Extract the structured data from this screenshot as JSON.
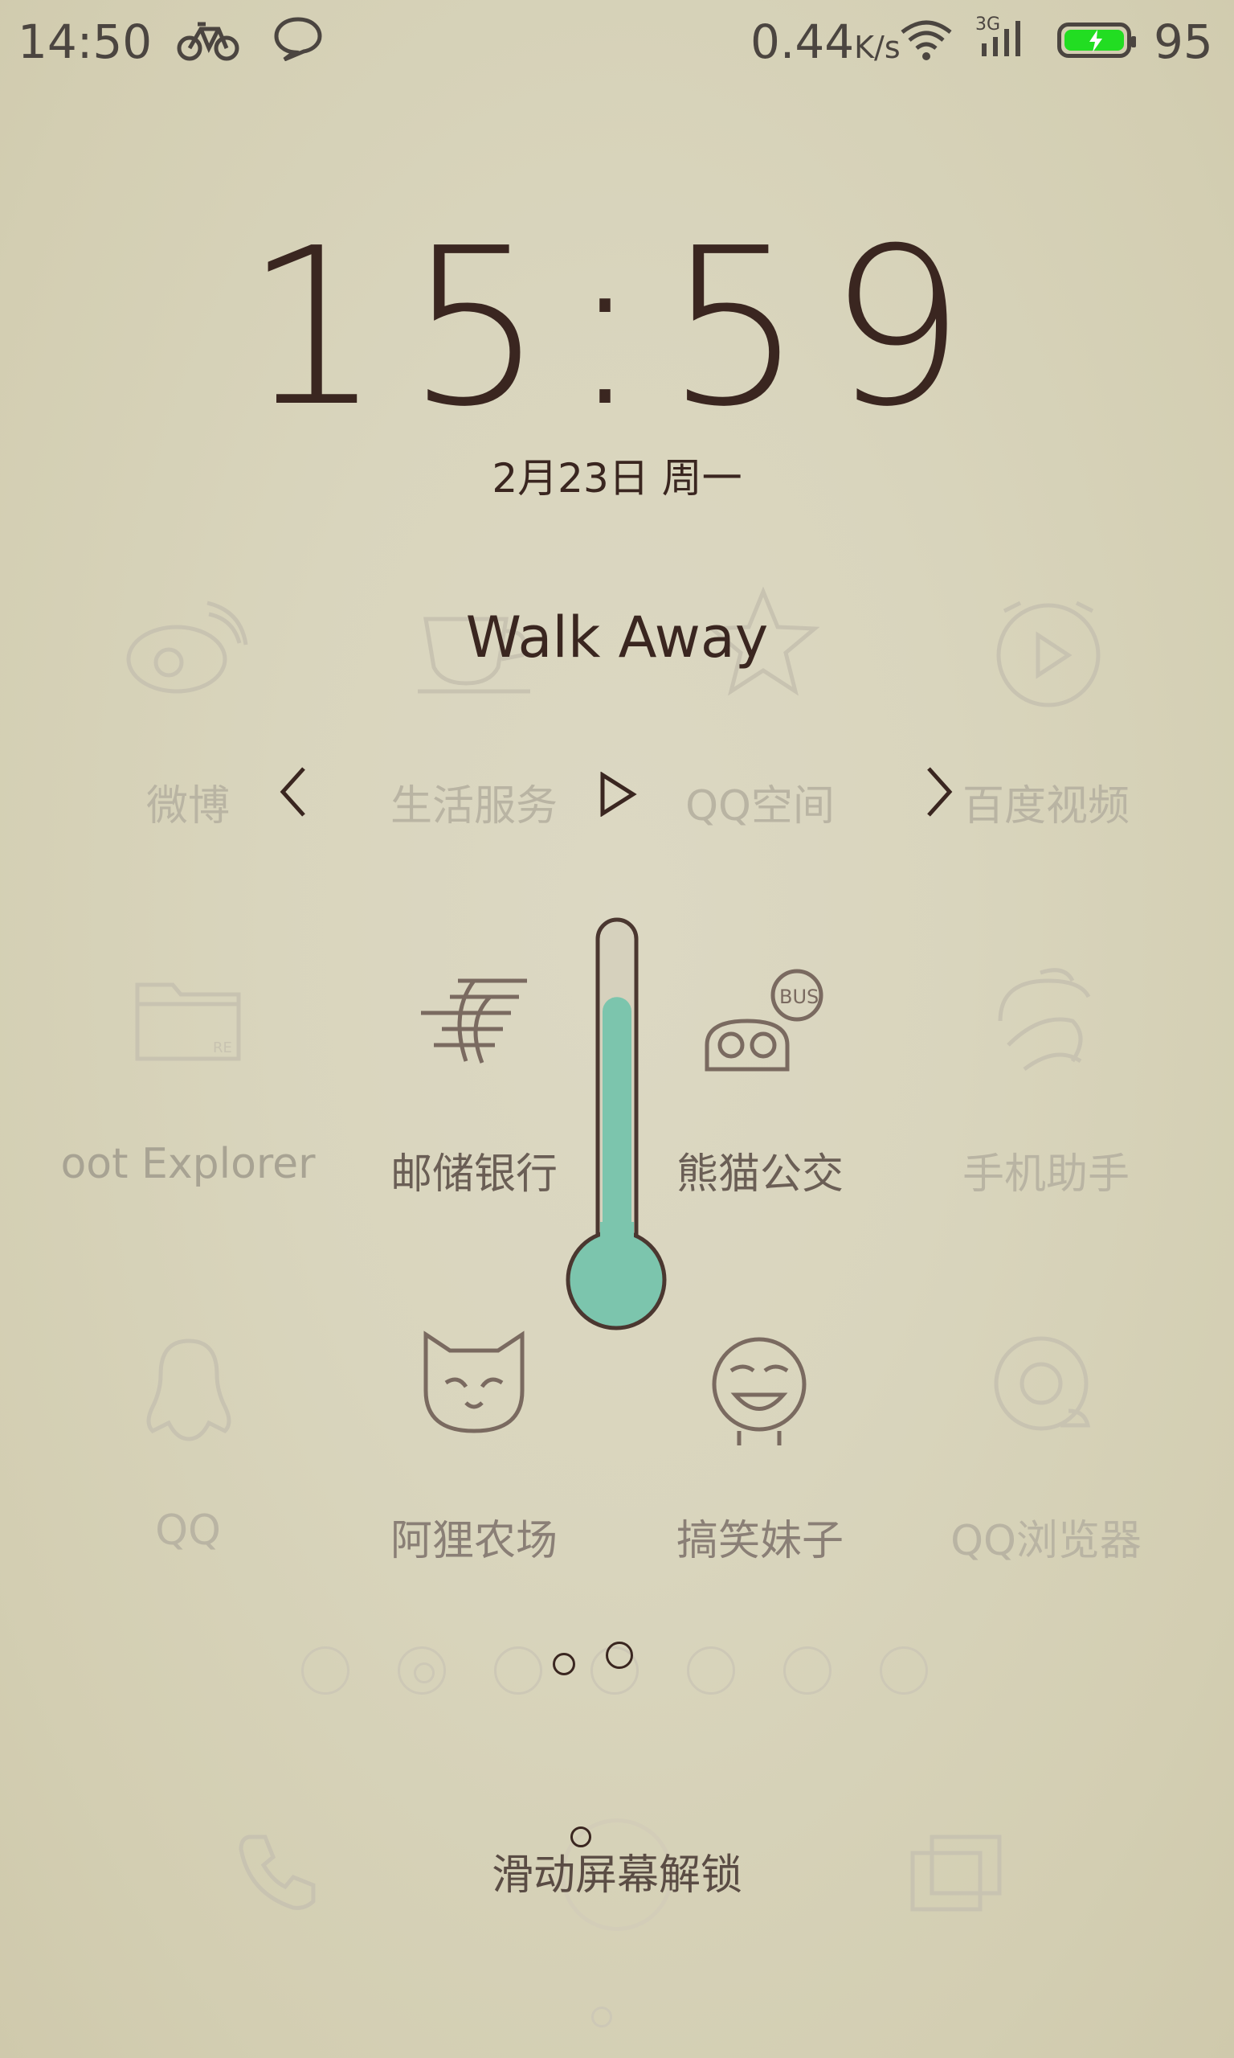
{
  "status_bar": {
    "time": "14:50",
    "net_speed": "0.44",
    "net_unit": "K/s",
    "signal_type": "3G",
    "battery": "95",
    "icons": [
      "bicycle-icon",
      "chat-bubble-icon",
      "wifi-icon",
      "signal-icon",
      "battery-charging-icon"
    ],
    "battery_color": "#22dd22"
  },
  "lockscreen": {
    "clock": "15:59",
    "date": "2月23日  周一",
    "song_title": "Walk Away",
    "unlock_hint": "滑动屏幕解锁"
  },
  "apps_row1": [
    {
      "label": "微博",
      "icon": "weibo-icon"
    },
    {
      "label": "生活服务",
      "icon": "cup-icon"
    },
    {
      "label": "QQ空间",
      "icon": "star-icon"
    },
    {
      "label": "百度视频",
      "icon": "video-play-icon"
    }
  ],
  "music_controls": {
    "prev": "prev-icon",
    "play": "play-icon",
    "next": "next-icon"
  },
  "apps_row2": [
    {
      "label": "oot Explorer",
      "icon": "folder-icon"
    },
    {
      "label": "邮储银行",
      "icon": "postal-bank-icon"
    },
    {
      "label": "熊猫公交",
      "icon": "panda-bus-icon",
      "badge": "BUS"
    },
    {
      "label": "手机助手",
      "icon": "phone-assistant-icon"
    }
  ],
  "apps_row3": [
    {
      "label": "QQ",
      "icon": "qq-penguin-icon"
    },
    {
      "label": "阿狸农场",
      "icon": "fox-icon"
    },
    {
      "label": "搞笑妹子",
      "icon": "funny-girl-icon"
    },
    {
      "label": "QQ浏览器",
      "icon": "qq-browser-icon"
    }
  ],
  "thermometer": {
    "level": 0.78,
    "fill_color": "#7cc5ad"
  },
  "page_indicators": {
    "count": 7,
    "active_index": 1
  }
}
